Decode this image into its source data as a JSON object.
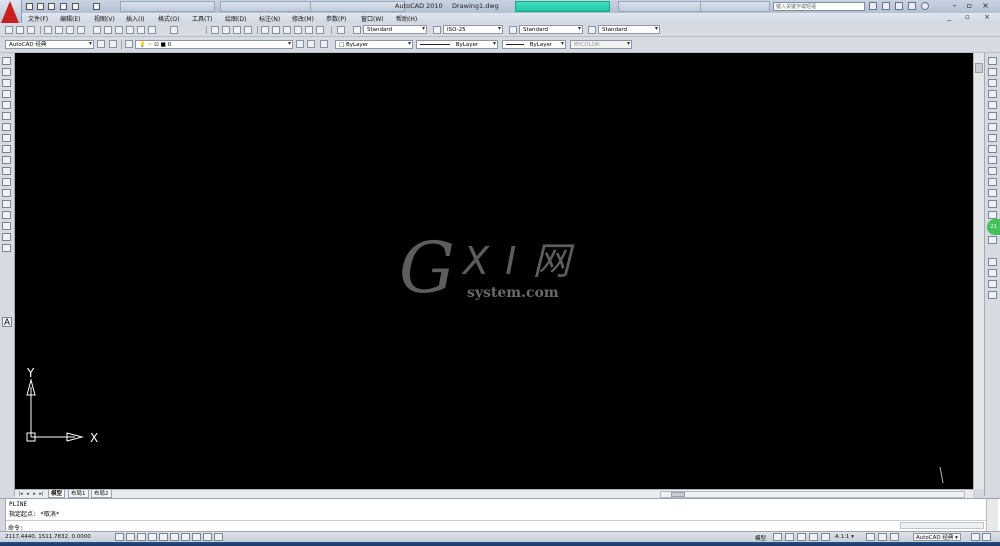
{
  "window": {
    "app_title": "AutoCAD 2010",
    "file_name": "Drawing1.dwg",
    "search_placeholder": "键入关键字或短语",
    "min_icon": "minimize-icon",
    "restore_icon": "restore-icon",
    "close_icon": "close-icon"
  },
  "menu": {
    "items": [
      "文件(F)",
      "编辑(E)",
      "视图(V)",
      "插入(I)",
      "格式(O)",
      "工具(T)",
      "绘图(D)",
      "标注(N)",
      "修改(M)",
      "参数(P)",
      "窗口(W)",
      "帮助(H)"
    ],
    "doc_controls": "_ ▫ ×"
  },
  "styles": {
    "text_style": "Standard",
    "dim_style": "ISO-25",
    "table_style": "Standard",
    "mleader_style": "Standard"
  },
  "layers": {
    "workspace": "AutoCAD 经典",
    "current_layer": "0",
    "color": "ByLayer",
    "linetype": "ByLayer",
    "lineweight": "ByLayer",
    "plotstyle": "BYCOLOR"
  },
  "ucs": {
    "y_label": "Y",
    "x_label": "X"
  },
  "watermark": {
    "g": "G",
    "xi": "X I 网",
    "domain": "system.com"
  },
  "tabs": {
    "items": [
      "模型",
      "布局1",
      "布局2"
    ]
  },
  "command": {
    "line1": "PLINE",
    "line2": "指定起点: *取消*",
    "prompt": "命令:"
  },
  "status": {
    "coords": "2117.4440, 1511.7832, 0.0000",
    "model": "模型",
    "scale": "A 1:1 ▾",
    "workspace": "AutoCAD 经典 ▾"
  },
  "badge": {
    "text": "21"
  },
  "colors": {
    "canvas": "#000000",
    "accent_green": "#43c15a",
    "logo_red": "#c8201f"
  }
}
